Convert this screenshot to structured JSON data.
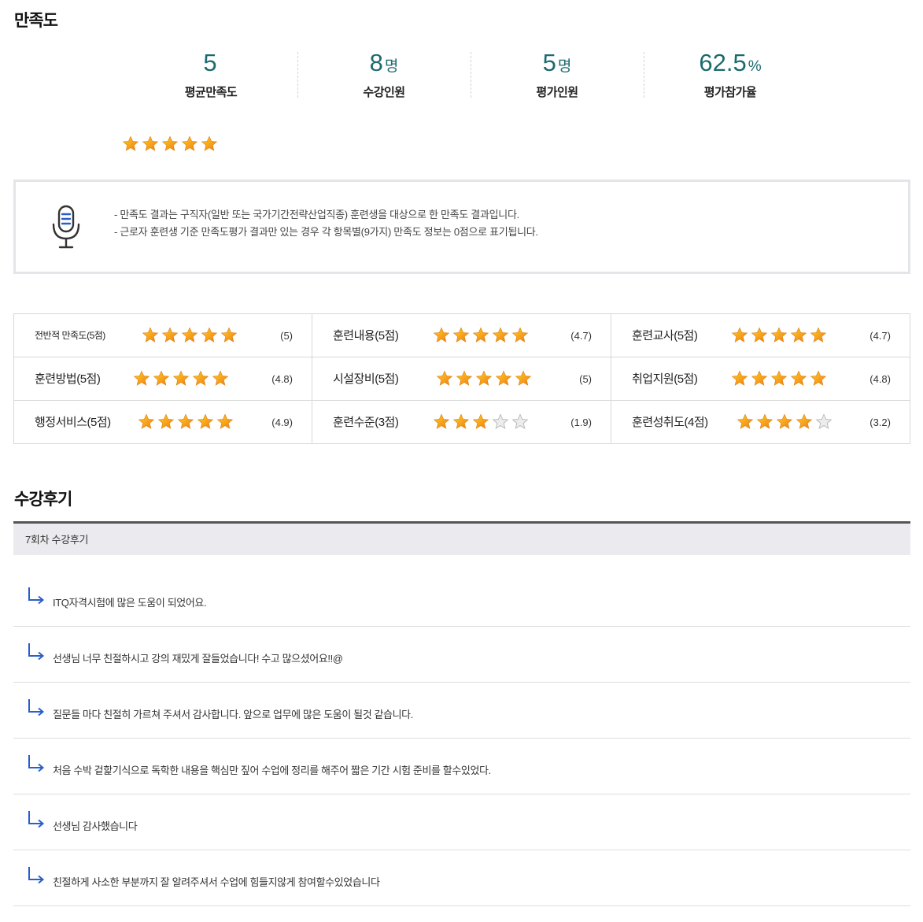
{
  "satisfaction": {
    "title": "만족도",
    "stats": [
      {
        "value": "5",
        "unit": "",
        "label": "평균만족도"
      },
      {
        "value": "8",
        "unit": "명",
        "label": "수강인원"
      },
      {
        "value": "5",
        "unit": "명",
        "label": "평가인원"
      },
      {
        "value": "62.5",
        "unit": "%",
        "label": "평가참가율"
      }
    ],
    "overall_stars": 5,
    "notice_lines": [
      "- 만족도 결과는 구직자(일반 또는 국가기간전략산업직종) 훈련생을 대상으로 한 만족도 결과입니다.",
      "- 근로자 훈련생 기준 만족도평가 결과만 있는 경우 각 항목별(9가지) 만족도 정보는 0점으로 표기됩니다."
    ],
    "ratings": [
      {
        "label": "전반적 만족도(5점)",
        "stars": 5,
        "score": "(5)"
      },
      {
        "label": "훈련내용(5점)",
        "stars": 5,
        "score": "(4.7)"
      },
      {
        "label": "훈련교사(5점)",
        "stars": 5,
        "score": "(4.7)"
      },
      {
        "label": "훈련방법(5점)",
        "stars": 5,
        "score": "(4.8)"
      },
      {
        "label": "시설장비(5점)",
        "stars": 5,
        "score": "(5)"
      },
      {
        "label": "취업지원(5점)",
        "stars": 5,
        "score": "(4.8)"
      },
      {
        "label": "행정서비스(5점)",
        "stars": 5,
        "score": "(4.9)"
      },
      {
        "label": "훈련수준(3점)",
        "stars": 3,
        "score": "(1.9)"
      },
      {
        "label": "훈련성취도(4점)",
        "stars": 4,
        "score": "(3.2)"
      }
    ]
  },
  "reviews": {
    "title": "수강후기",
    "round_label": "7회차 수강후기",
    "items": [
      "ITQ자격시험에 많은 도움이 되었어요.",
      "선생님 너무 친절하시고 강의 재밌게 잘들었습니다! 수고 많으셨어요!!@",
      "질문들 마다 친절히 가르쳐 주셔서 감사합니다. 앞으로 업무에 많은 도움이 될것 같습니다.",
      "처음 수박 겉핥기식으로 독학한 내용을 핵심만 짚어 수업에 정리를 해주어 짧은 기간 시험 준비를 할수있었다.",
      "선생님 감사했습니다",
      "친절하게 사소한 부분까지 잘 알려주셔서 수업에 힘들지않게 참여할수있었습니다"
    ]
  },
  "colors": {
    "accent": "#1d6a6e",
    "star_filled": "#f7a21b",
    "star_empty": "#d9d9d9",
    "arrow": "#2a5fc8"
  }
}
